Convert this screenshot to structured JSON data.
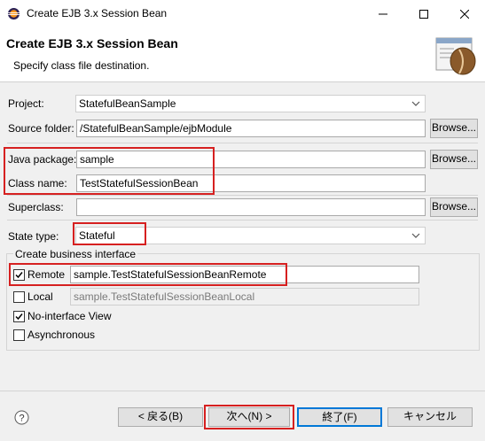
{
  "window": {
    "title": "Create EJB 3.x Session Bean"
  },
  "header": {
    "title": "Create EJB 3.x Session Bean",
    "description": "Specify class file destination."
  },
  "form": {
    "project_label": "Project:",
    "project_value": "StatefulBeanSample",
    "source_folder_label": "Source folder:",
    "source_folder_value": "/StatefulBeanSample/ejbModule",
    "java_package_label": "Java package:",
    "java_package_value": "sample",
    "class_name_label": "Class name:",
    "class_name_value": "TestStatefulSessionBean",
    "superclass_label": "Superclass:",
    "superclass_value": "",
    "state_type_label": "State type:",
    "state_type_value": "Stateful",
    "browse_label": "Browse..."
  },
  "business_interface": {
    "group_title": "Create business interface",
    "remote_label": "Remote",
    "remote_checked": true,
    "remote_value": "sample.TestStatefulSessionBeanRemote",
    "local_label": "Local",
    "local_checked": false,
    "local_value": "sample.TestStatefulSessionBeanLocal",
    "no_interface_label": "No-interface View",
    "no_interface_checked": true,
    "asynchronous_label": "Asynchronous",
    "asynchronous_checked": false
  },
  "buttons": {
    "back": "< 戻る(B)",
    "next": "次へ(N) >",
    "finish": "終了(F)",
    "cancel": "キャンセル"
  },
  "colors": {
    "highlight": "#d62020",
    "default_button": "#0078d7"
  }
}
